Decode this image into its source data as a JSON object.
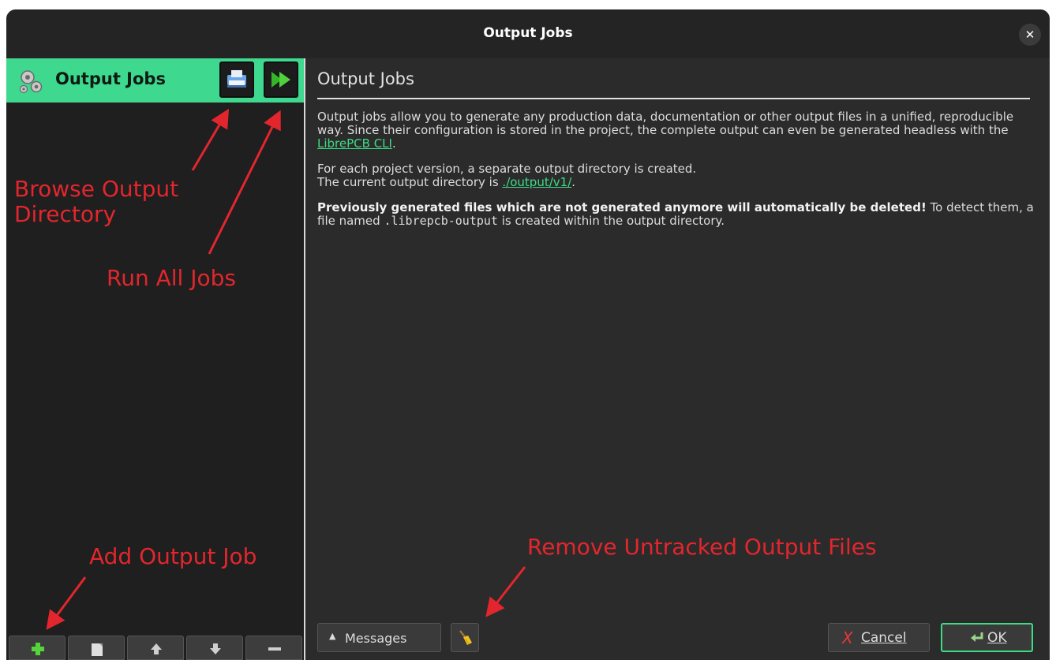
{
  "window": {
    "title": "Output Jobs",
    "close_symbol": "✕"
  },
  "left_panel": {
    "header_label": "Output Jobs",
    "header_buttons": [
      "browse-output-directory",
      "run-all-jobs"
    ],
    "toolbar_buttons": [
      "add",
      "copy",
      "move-up",
      "move-down",
      "remove"
    ]
  },
  "right_panel": {
    "title": "Output Jobs",
    "para1_text": "Output jobs allow you to generate any production data, documentation or other output files in a unified, reproducible way. Since their configuration is stored in the project, the complete output can even be generated headless with the ",
    "para1_link": "LibrePCB CLI",
    "para1_end": ".",
    "para2_line1": "For each project version, a separate output directory is created.",
    "para2_line2": "The current output directory is ",
    "para2_link": "./output/v1/",
    "para2_end": ".",
    "para3_bold": "Previously generated files which are not generated anymore will automatically be deleted!",
    "para3_text1": " To detect them, a file named ",
    "para3_mono": ".librepcb-output",
    "para3_text2": " is created within the output directory."
  },
  "buttons": {
    "messages_arrow": "▲",
    "messages_label": "Messages",
    "cancel_icon": "X",
    "cancel_label": "Cancel",
    "ok_label": "OK"
  },
  "annotations": {
    "browse_line1": "Browse Output",
    "browse_line2": "Directory",
    "run_all": "Run All Jobs",
    "add_job": "Add Output Job",
    "remove_untracked": "Remove Untracked Output Files"
  },
  "colors": {
    "accent": "#3fd88f",
    "link": "#3ddc84",
    "annotation": "#e3262d",
    "background": "#2b2b2b"
  }
}
